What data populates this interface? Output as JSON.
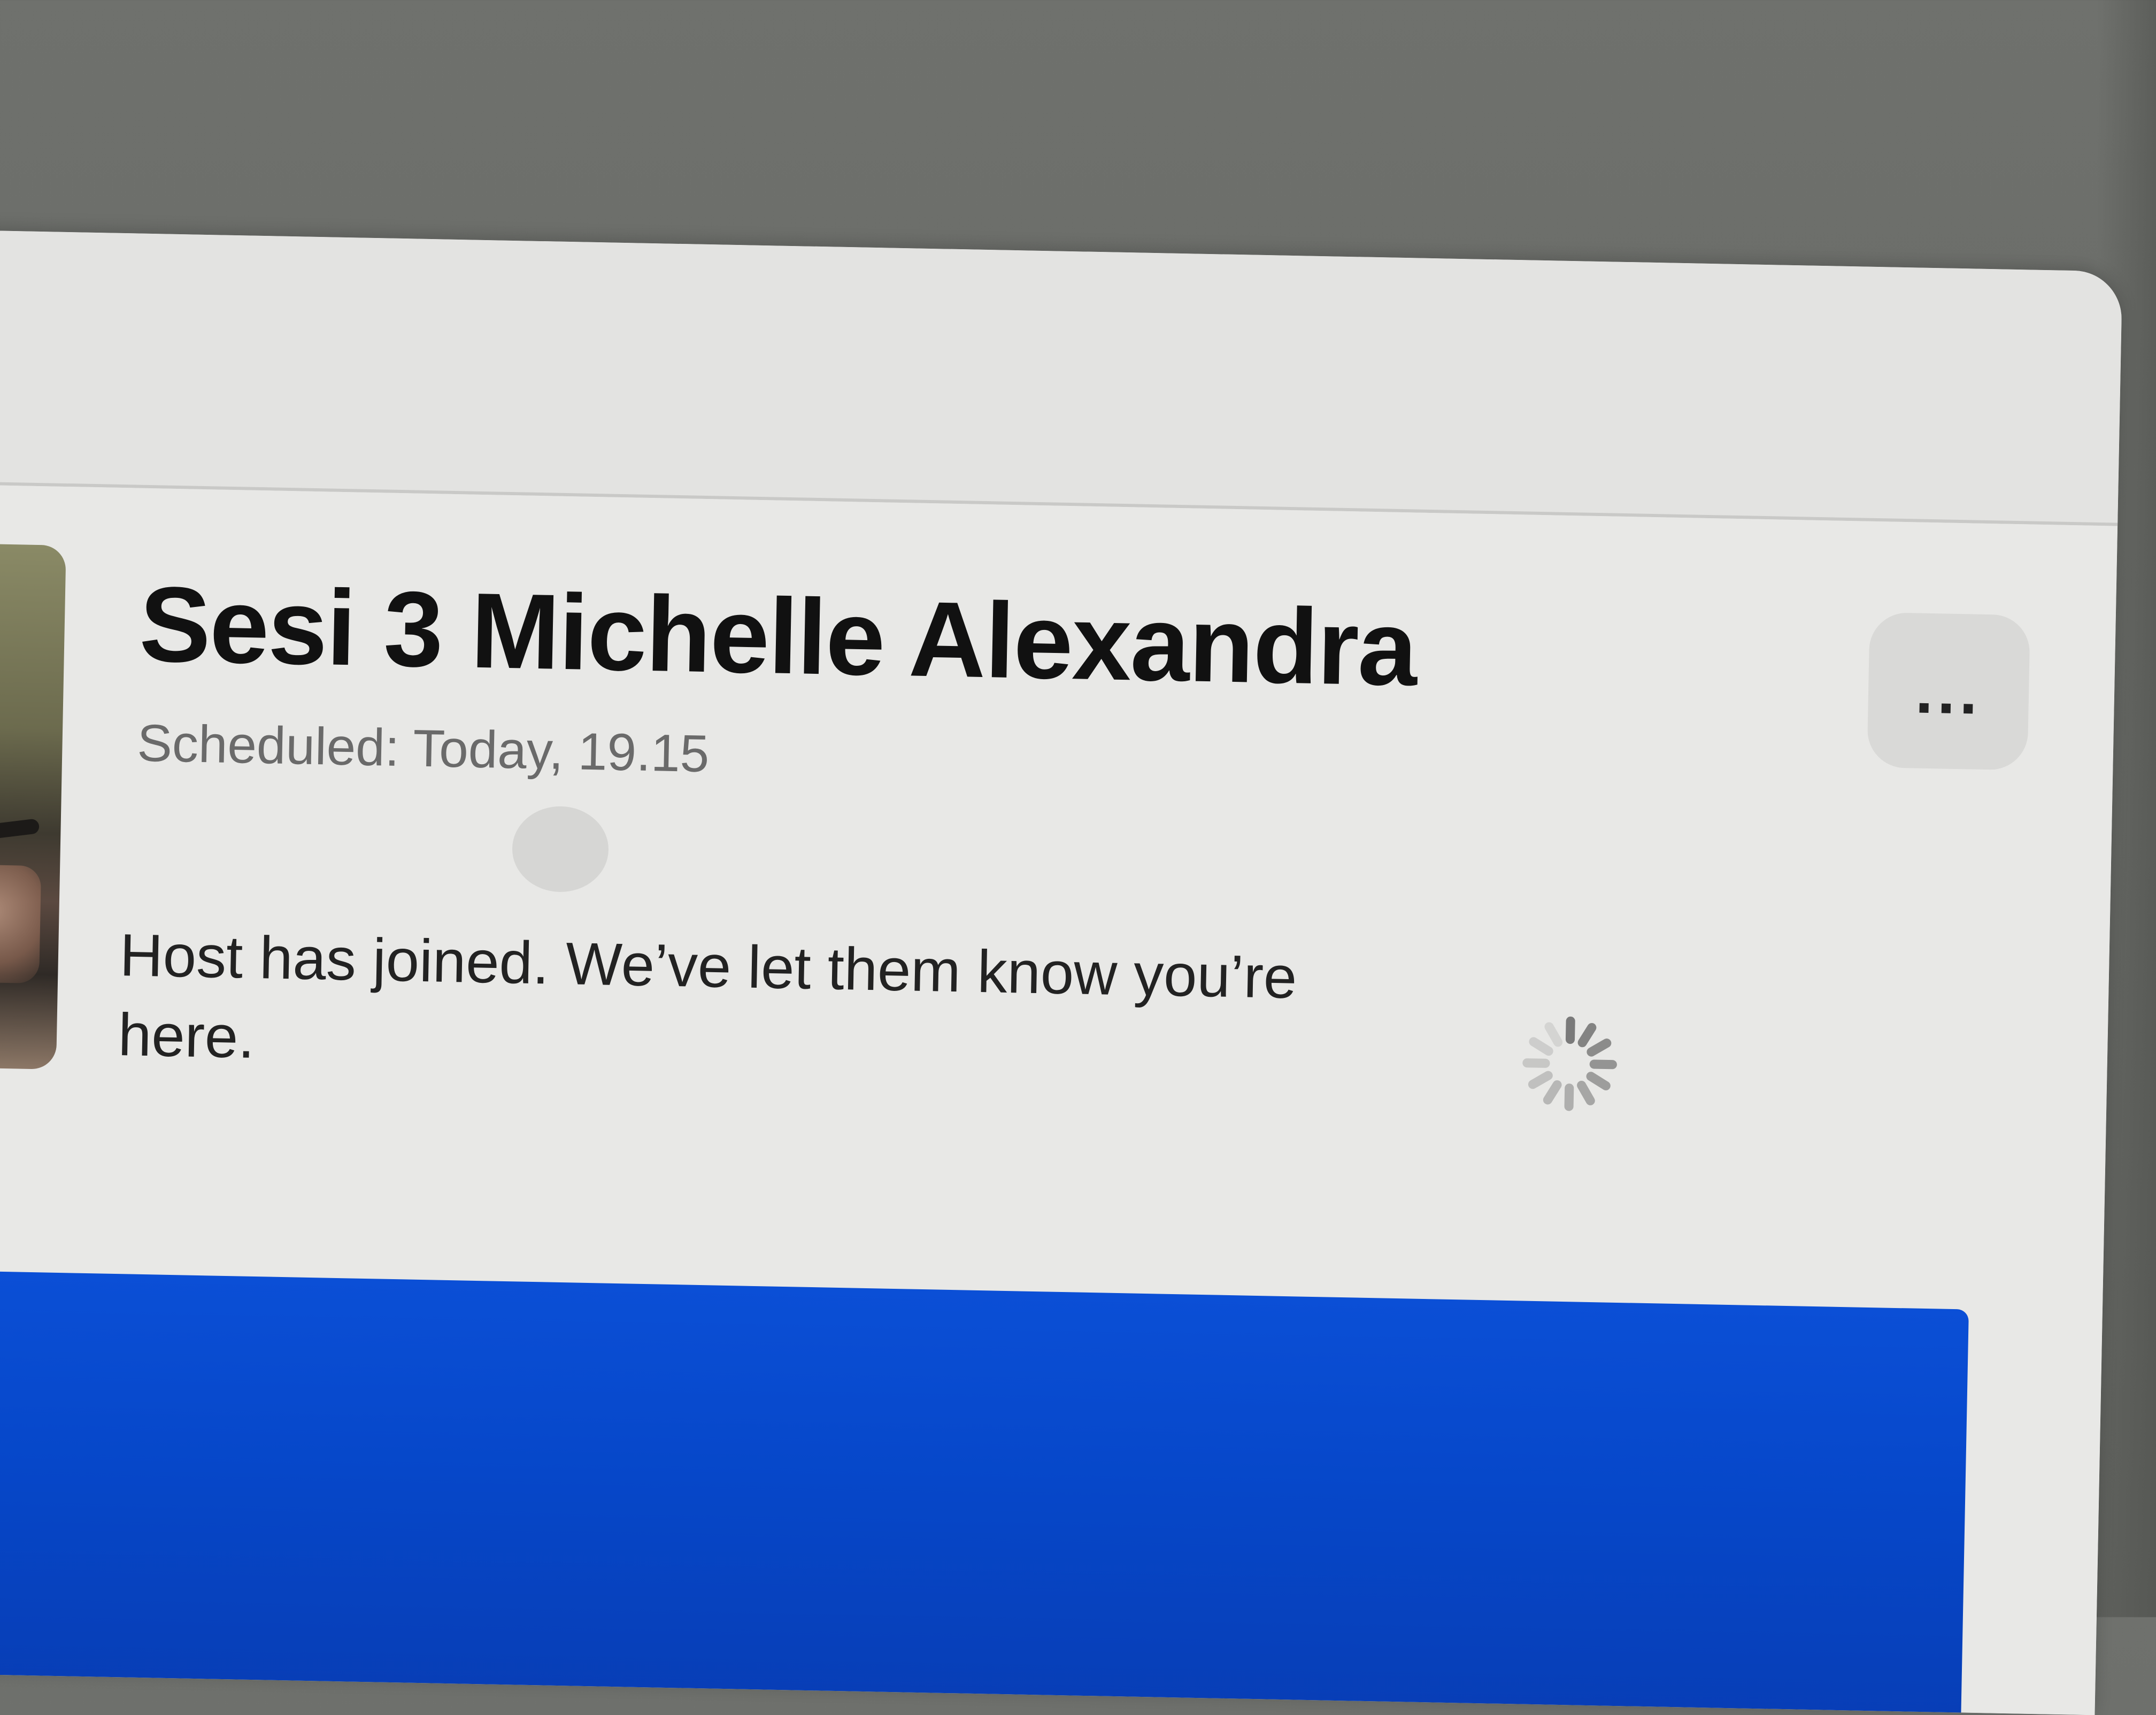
{
  "session": {
    "title": "Sesi 3 Michelle Alexandra",
    "scheduled": "Scheduled: Today, 19.15",
    "status_message": "Host has joined. We’ve let them know you’re here.",
    "more_label": "..."
  },
  "colors": {
    "panel_blue": "#0647c9",
    "window_bg": "#e6e6e4",
    "backdrop": "#6a6c68"
  },
  "icons": {
    "more": "more-options-icon",
    "loading": "loading-spinner-icon"
  }
}
